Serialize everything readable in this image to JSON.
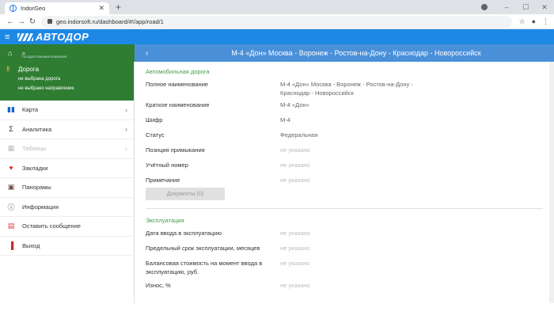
{
  "browser": {
    "tab_title": "IndorGeo",
    "url": "geo.indorsoft.ru/dashboard/#!/app/road/1"
  },
  "app": {
    "logo": "АВТОДОР",
    "logo_sub": "ГОСУДАРСТВЕННАЯ КОМПАНИЯ",
    "road_title": "М-4 «Дон» Москва - Воронеж - Ростов-на-Дону - Краснодар - Новороссийск"
  },
  "sidebar": {
    "road": {
      "label": "Дорога",
      "road_status": "не выбрана дорога",
      "direction_status": "не выбрано направление"
    },
    "items": [
      {
        "label": "Карта",
        "icon": "map-icon",
        "has_chevron": true,
        "disabled": false
      },
      {
        "label": "Аналитика",
        "icon": "sigma-icon",
        "has_chevron": true,
        "disabled": false
      },
      {
        "label": "Таблицы",
        "icon": "table-icon",
        "has_chevron": true,
        "disabled": true
      },
      {
        "label": "Закладки",
        "icon": "bookmark-icon",
        "has_chevron": false,
        "disabled": false
      },
      {
        "label": "Панорамы",
        "icon": "panorama-icon",
        "has_chevron": false,
        "disabled": false
      },
      {
        "label": "Информация",
        "icon": "info-icon",
        "has_chevron": false,
        "disabled": false
      },
      {
        "label": "Оставить сообщение",
        "icon": "calendar-icon",
        "has_chevron": false,
        "disabled": false
      },
      {
        "label": "Выход",
        "icon": "exit-icon",
        "has_chevron": false,
        "disabled": false
      }
    ]
  },
  "main": {
    "section1": {
      "title": "Автомобильная дорога",
      "rows": [
        {
          "key": "Полное наименование",
          "value": "М-4 «Дон» Москва - Воронеж - Ростов-на-Дону - Краснодар - Новороссийск"
        },
        {
          "key": "Краткое наименование",
          "value": "М-4 «Дон»"
        },
        {
          "key": "Шифр",
          "value": "М-4"
        },
        {
          "key": "Статус",
          "value": "Федеральная"
        },
        {
          "key": "Позиция примыкания",
          "value": "не указано"
        },
        {
          "key": "Учётный номер",
          "value": "не указано"
        },
        {
          "key": "Примечание",
          "value": "не указано"
        }
      ],
      "documents_button": "Документы (0)"
    },
    "section2": {
      "title": "Эксплуатация",
      "rows": [
        {
          "key": "Дата ввода в эксплуатацию",
          "value": "не указано"
        },
        {
          "key": "Предельный срок эксплуатации, месяцев",
          "value": "не указано"
        },
        {
          "key": "Балансовая стоимость на момент ввода в эксплуатацию, руб.",
          "value": "не указано"
        },
        {
          "key": "Износ, %",
          "value": "не указано"
        }
      ]
    }
  },
  "colors": {
    "header_blue": "#1e88e5",
    "appbar_blue": "#4a90d9",
    "green": "#2e7d32",
    "section_green": "#43a047"
  }
}
